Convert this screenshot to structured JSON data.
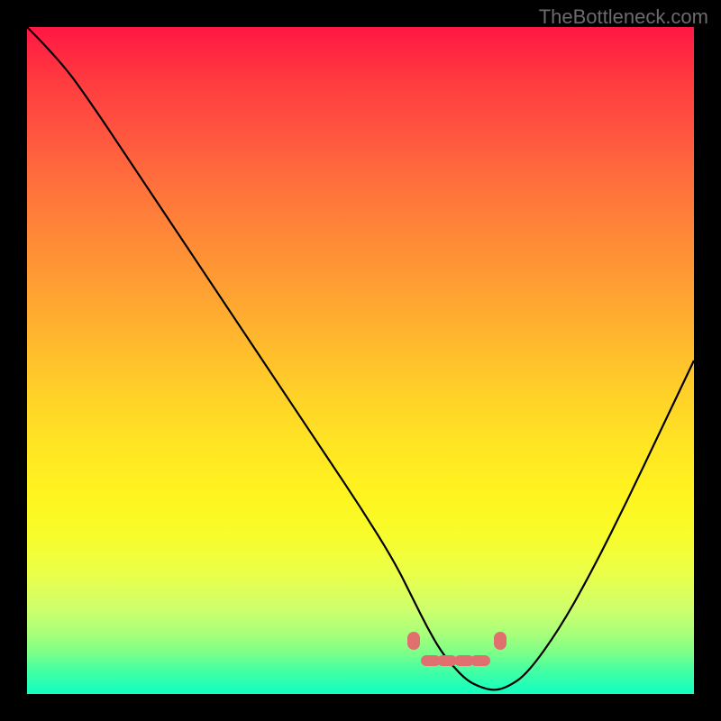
{
  "attribution": "TheBottleneck.com",
  "colors": {
    "top": "#ff1744",
    "bottom": "#10ffc0",
    "curve": "#000000",
    "marker": "#e07070",
    "background": "#000000"
  },
  "chart_data": {
    "type": "line",
    "title": "",
    "xlabel": "",
    "ylabel": "",
    "xlim": [
      0,
      100
    ],
    "ylim": [
      0,
      100
    ],
    "x": [
      0,
      5,
      10,
      15,
      20,
      25,
      30,
      35,
      40,
      45,
      50,
      55,
      58,
      60,
      62,
      64,
      66,
      68,
      70,
      72,
      75,
      80,
      85,
      90,
      95,
      100
    ],
    "values": [
      100,
      95,
      88,
      80.5,
      73,
      65.5,
      58,
      50.5,
      43,
      35.5,
      28,
      20,
      14,
      10,
      6.5,
      4,
      2,
      1,
      0.5,
      1,
      3,
      10,
      19,
      29,
      39.5,
      50
    ],
    "series_name": "bottleneck-curve",
    "markers": {
      "left_bracket": {
        "x": 58,
        "y": 8
      },
      "right_bracket": {
        "x": 71,
        "y": 8
      },
      "bottom_segments": [
        {
          "x": 60.5,
          "y": 5
        },
        {
          "x": 63,
          "y": 5
        },
        {
          "x": 65.5,
          "y": 5
        },
        {
          "x": 68,
          "y": 5
        }
      ]
    }
  }
}
